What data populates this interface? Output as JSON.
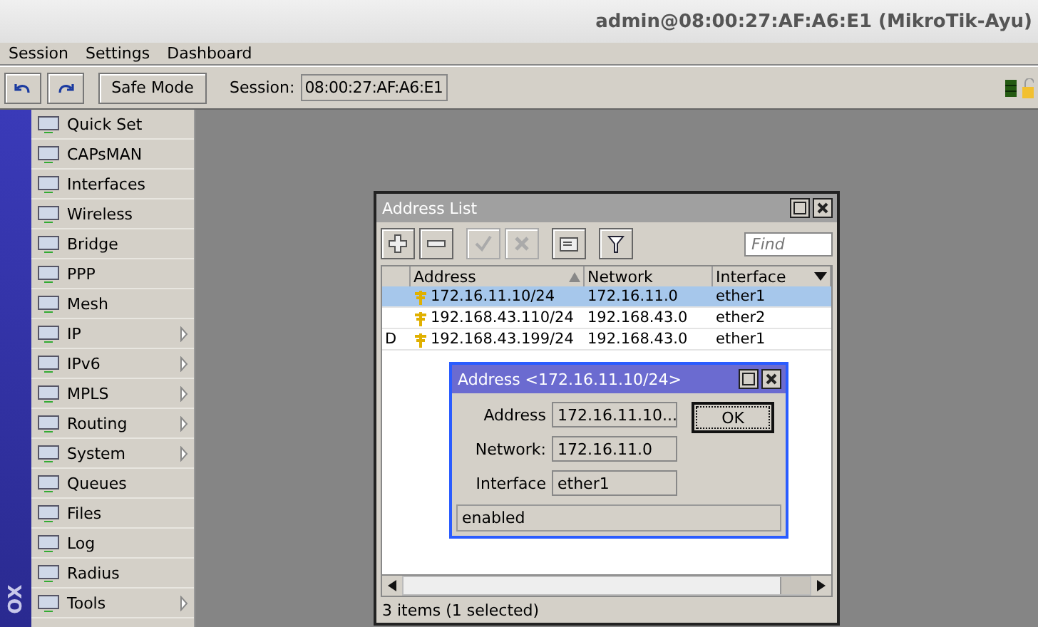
{
  "window": {
    "title": "admin@08:00:27:AF:A6:E1 (MikroTik-Ayu)"
  },
  "menu": [
    "Session",
    "Settings",
    "Dashboard"
  ],
  "toolbar": {
    "safe_mode": "Safe Mode",
    "session_label": "Session:",
    "session_value": "08:00:27:AF:A6:E1"
  },
  "side_strip": {
    "text": "OX"
  },
  "sidebar": {
    "items": [
      {
        "label": "Quick Set",
        "has_submenu": false
      },
      {
        "label": "CAPsMAN",
        "has_submenu": false
      },
      {
        "label": "Interfaces",
        "has_submenu": false
      },
      {
        "label": "Wireless",
        "has_submenu": false
      },
      {
        "label": "Bridge",
        "has_submenu": false
      },
      {
        "label": "PPP",
        "has_submenu": false
      },
      {
        "label": "Mesh",
        "has_submenu": false
      },
      {
        "label": "IP",
        "has_submenu": true
      },
      {
        "label": "IPv6",
        "has_submenu": true
      },
      {
        "label": "MPLS",
        "has_submenu": true
      },
      {
        "label": "Routing",
        "has_submenu": true
      },
      {
        "label": "System",
        "has_submenu": true
      },
      {
        "label": "Queues",
        "has_submenu": false
      },
      {
        "label": "Files",
        "has_submenu": false
      },
      {
        "label": "Log",
        "has_submenu": false
      },
      {
        "label": "Radius",
        "has_submenu": false
      },
      {
        "label": "Tools",
        "has_submenu": true
      }
    ]
  },
  "address_list": {
    "title": "Address List",
    "buttons": [
      {
        "kind": "add",
        "disabled": false
      },
      {
        "kind": "remove",
        "disabled": false
      },
      {
        "kind": "enable",
        "disabled": true
      },
      {
        "kind": "disable",
        "disabled": true
      },
      {
        "kind": "comment",
        "disabled": false
      },
      {
        "kind": "filter",
        "disabled": false
      }
    ],
    "find": {
      "placeholder": "Find"
    },
    "columns": [
      "Address",
      "Network",
      "Interface"
    ],
    "rows": [
      {
        "flag": "",
        "address": "172.16.11.10/24",
        "network": "172.16.11.0",
        "interface": "ether1",
        "selected": true
      },
      {
        "flag": "",
        "address": "192.168.43.110/24",
        "network": "192.168.43.0",
        "interface": "ether2",
        "selected": false
      },
      {
        "flag": "D",
        "address": "192.168.43.199/24",
        "network": "192.168.43.0",
        "interface": "ether1",
        "selected": false
      }
    ],
    "status": "3 items (1 selected)"
  },
  "dialog": {
    "title": "Address <172.16.11.10/24>",
    "fields": [
      {
        "label": "Address",
        "value": "172.16.11.10..."
      },
      {
        "label": "Network:",
        "value": "172.16.11.0"
      },
      {
        "label": "Interface",
        "value": "ether1"
      }
    ],
    "ok": "OK",
    "status": "enabled"
  }
}
